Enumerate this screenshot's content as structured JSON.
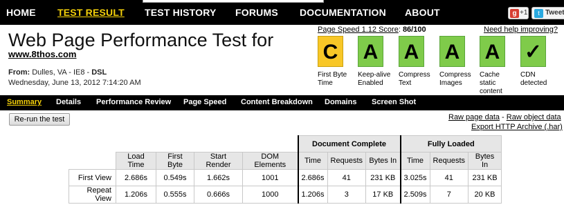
{
  "nav": {
    "items": [
      "HOME",
      "TEST RESULT",
      "TEST HISTORY",
      "FORUMS",
      "DOCUMENTATION",
      "ABOUT"
    ],
    "active": "TEST RESULT",
    "gplus_label": "+1",
    "tweet_label": "Tweet"
  },
  "header": {
    "title": "Web Page Performance Test for",
    "site": "www.8thos.com",
    "from_label": "From:",
    "from_value": "Dulles, VA - IE8 - ",
    "connection": "DSL",
    "date": "Wednesday, June 13, 2012 7:14:20 AM"
  },
  "pagespeed": {
    "label": "Page Speed 1.12 Score",
    "score": "86/100",
    "help": "Need help improving?"
  },
  "grades": [
    {
      "grade": "C",
      "label": "First Byte Time",
      "color": "#f8c727"
    },
    {
      "grade": "A",
      "label": "Keep-alive Enabled",
      "color": "#7fcb4a"
    },
    {
      "grade": "A",
      "label": "Compress Text",
      "color": "#7fcb4a"
    },
    {
      "grade": "A",
      "label": "Compress Images",
      "color": "#7fcb4a"
    },
    {
      "grade": "A",
      "label": "Cache static content",
      "color": "#7fcb4a"
    },
    {
      "grade": "✓",
      "label": "CDN detected",
      "color": "#7fcb4a"
    }
  ],
  "tabs": [
    "Summary",
    "Details",
    "Performance Review",
    "Page Speed",
    "Content Breakdown",
    "Domains",
    "Screen Shot"
  ],
  "actions": {
    "rerun": "Re-run the test",
    "raw_page": "Raw page data",
    "sep": " - ",
    "raw_object": "Raw object data",
    "export": "Export HTTP Archive (.har)"
  },
  "table": {
    "groups": {
      "doc": "Document Complete",
      "full": "Fully Loaded"
    },
    "headers": [
      "Load Time",
      "First Byte",
      "Start Render",
      "DOM Elements",
      "Time",
      "Requests",
      "Bytes In",
      "Time",
      "Requests",
      "Bytes In"
    ],
    "rows": [
      {
        "label": "First View",
        "cells": [
          "2.686s",
          "0.549s",
          "1.662s",
          "1001",
          "2.686s",
          "41",
          "231 KB",
          "3.025s",
          "41",
          "231 KB"
        ]
      },
      {
        "label": "Repeat View",
        "cells": [
          "1.206s",
          "0.555s",
          "0.666s",
          "1000",
          "1.206s",
          "3",
          "17 KB",
          "2.509s",
          "7",
          "20 KB"
        ]
      }
    ]
  }
}
